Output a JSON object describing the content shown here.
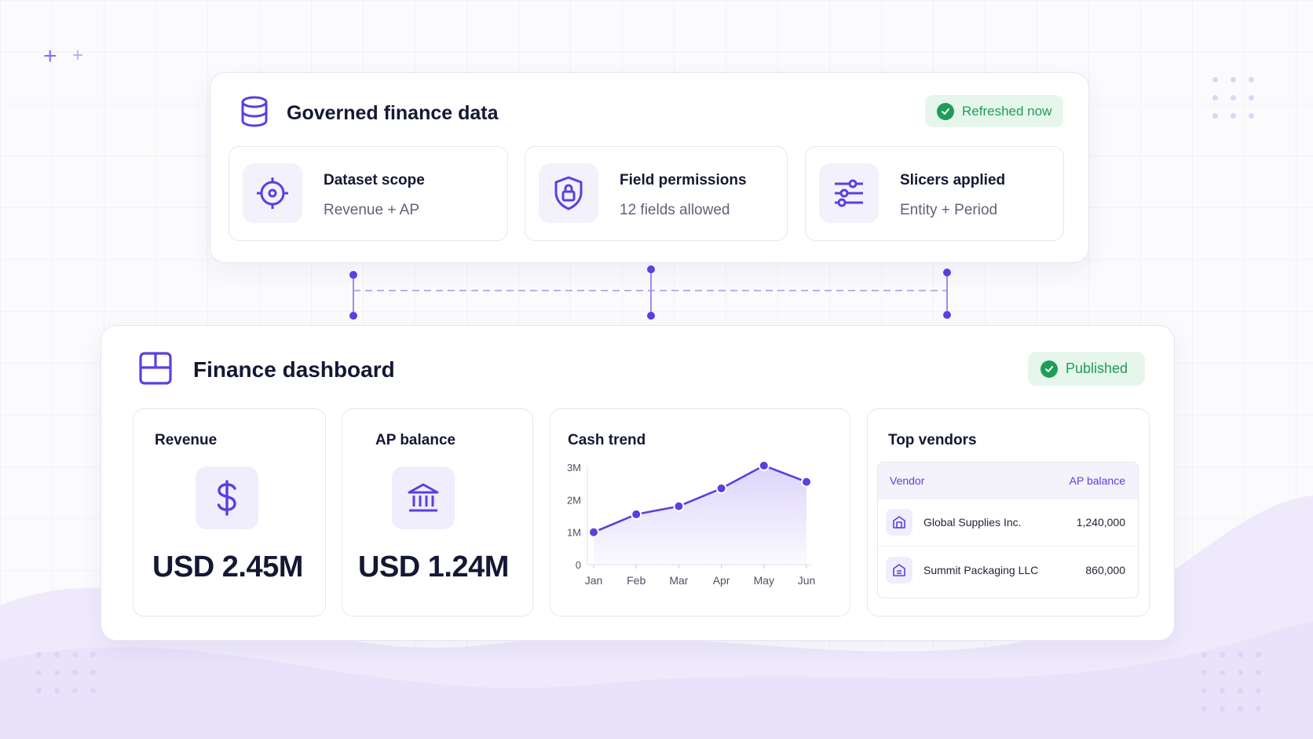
{
  "governed": {
    "title": "Governed finance data",
    "badge": "Refreshed now",
    "tiles": [
      {
        "title": "Dataset scope",
        "value": "Revenue + AP",
        "icon": "target-icon"
      },
      {
        "title": "Field permissions",
        "value": "12 fields allowed",
        "icon": "shield-lock-icon"
      },
      {
        "title": "Slicers applied",
        "value": "Entity + Period",
        "icon": "sliders-icon"
      }
    ]
  },
  "dashboard": {
    "title": "Finance dashboard",
    "badge": "Published",
    "revenue": {
      "label": "Revenue",
      "value": "USD 2.45M",
      "icon": "dollar-icon"
    },
    "ap": {
      "label": "AP balance",
      "value": "USD 1.24M",
      "icon": "bank-icon"
    },
    "cash_trend": {
      "title": "Cash trend"
    },
    "vendors": {
      "title": "Top vendors",
      "columns": [
        "Vendor",
        "AP balance"
      ],
      "rows": [
        {
          "name": "Global Supplies Inc.",
          "value": "1,240,000"
        },
        {
          "name": "Summit Packaging LLC",
          "value": "860,000"
        }
      ]
    }
  },
  "colors": {
    "accent": "#5b3fe0",
    "success": "#1f9d56",
    "success_bg": "#e6f6ec"
  },
  "chart_data": {
    "type": "area",
    "title": "Cash trend",
    "categories": [
      "Jan",
      "Feb",
      "Mar",
      "Apr",
      "May",
      "Jun"
    ],
    "values": [
      1.0,
      1.55,
      1.8,
      2.35,
      3.05,
      2.55
    ],
    "y_ticks": [
      "0",
      "1M",
      "2M",
      "3M"
    ],
    "ylim": [
      0,
      3
    ],
    "grid": false
  }
}
